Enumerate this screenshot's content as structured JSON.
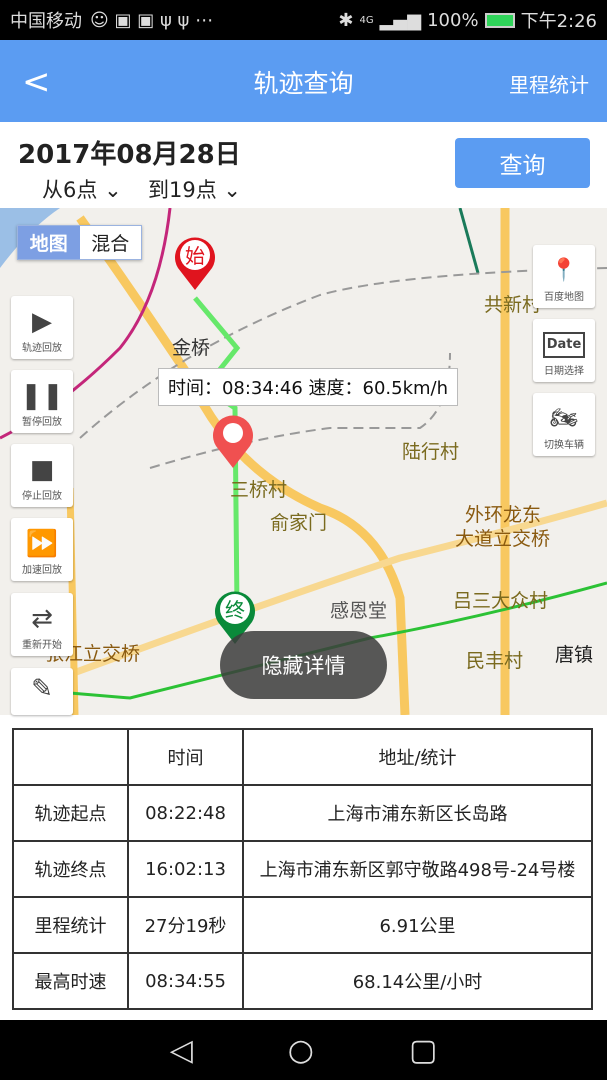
{
  "status_bar": {
    "carrier": "中国移动",
    "battery": "100%",
    "network": "4G",
    "time": "下午2:26"
  },
  "header": {
    "back_icon": "chevron-left-icon",
    "title": "轨迹查询",
    "right_link": "里程统计"
  },
  "query": {
    "date": "2017年08月28日",
    "from": "从6点",
    "to": "到19点",
    "button": "查询"
  },
  "map": {
    "toggle": [
      "地图",
      "混合"
    ],
    "left_controls": [
      {
        "label": "轨迹回放",
        "icon": "play-icon"
      },
      {
        "label": "暂停回放",
        "icon": "pause-icon"
      },
      {
        "label": "停止回放",
        "icon": "stop-icon"
      },
      {
        "label": "加速回放",
        "icon": "fast-forward-icon"
      },
      {
        "label": "重新开始",
        "icon": "repeat-icon"
      },
      {
        "label": "",
        "icon": "pen-icon"
      }
    ],
    "right_controls": [
      {
        "label": "百度地图",
        "icon": "baidu-pin-icon"
      },
      {
        "label": "日期选择",
        "icon": "calendar-icon",
        "icon_text": "Date"
      },
      {
        "label": "切换车辆",
        "icon": "motorcycle-icon"
      }
    ],
    "tooltip": "时间：08:34:46 速度：60.5km/h",
    "start_marker": "始",
    "end_marker": "终",
    "places": [
      "金桥",
      "共新村",
      "陆行村",
      "三桥村",
      "俞家门",
      "外环龙东",
      "大道立交桥",
      "感恩堂",
      "吕三大众村",
      "民丰村",
      "唐镇",
      "张江立交桥"
    ],
    "hide_button": "隐藏详情",
    "route_color": "#66e86a"
  },
  "table": {
    "headers": [
      "",
      "时间",
      "地址/统计"
    ],
    "rows": [
      [
        "轨迹起点",
        "08:22:48",
        "上海市浦东新区长岛路"
      ],
      [
        "轨迹终点",
        "16:02:13",
        "上海市浦东新区郭守敬路498号-24号楼"
      ],
      [
        "里程统计",
        "27分19秒",
        "6.91公里"
      ],
      [
        "最高时速",
        "08:34:55",
        "68.14公里/小时"
      ]
    ]
  },
  "accent": "#5b9cf2"
}
